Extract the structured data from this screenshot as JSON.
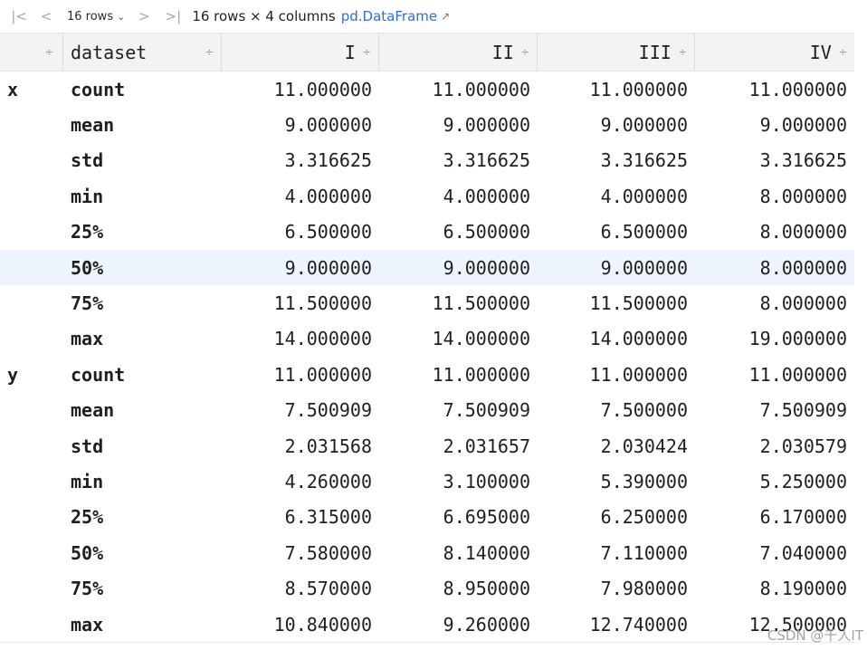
{
  "toolbar": {
    "first_icon": "|<",
    "prev_icon": "<",
    "rows_value": "16 rows",
    "chevron_icon": "⌄",
    "next_icon": ">",
    "last_icon": ">|",
    "summary": "16 rows × 4 columns",
    "dataframe_link": "pd.DataFrame",
    "external_icon": "↗"
  },
  "headers": {
    "index_sort": "÷",
    "dataset": "dataset",
    "dataset_sort": "÷",
    "columns": [
      {
        "label": "I",
        "sort": "÷"
      },
      {
        "label": "II",
        "sort": "÷"
      },
      {
        "label": "III",
        "sort": "÷"
      },
      {
        "label": "IV",
        "sort": "÷"
      }
    ]
  },
  "rows": [
    {
      "lvl0": "x",
      "lvl1": "count",
      "values": [
        "11.000000",
        "11.000000",
        "11.000000",
        "11.000000"
      ]
    },
    {
      "lvl0": "",
      "lvl1": "mean",
      "values": [
        "9.000000",
        "9.000000",
        "9.000000",
        "9.000000"
      ]
    },
    {
      "lvl0": "",
      "lvl1": "std",
      "values": [
        "3.316625",
        "3.316625",
        "3.316625",
        "3.316625"
      ]
    },
    {
      "lvl0": "",
      "lvl1": "min",
      "values": [
        "4.000000",
        "4.000000",
        "4.000000",
        "8.000000"
      ]
    },
    {
      "lvl0": "",
      "lvl1": "25%",
      "values": [
        "6.500000",
        "6.500000",
        "6.500000",
        "8.000000"
      ]
    },
    {
      "lvl0": "",
      "lvl1": "50%",
      "values": [
        "9.000000",
        "9.000000",
        "9.000000",
        "8.000000"
      ]
    },
    {
      "lvl0": "",
      "lvl1": "75%",
      "values": [
        "11.500000",
        "11.500000",
        "11.500000",
        "8.000000"
      ]
    },
    {
      "lvl0": "",
      "lvl1": "max",
      "values": [
        "14.000000",
        "14.000000",
        "14.000000",
        "19.000000"
      ]
    },
    {
      "lvl0": "y",
      "lvl1": "count",
      "values": [
        "11.000000",
        "11.000000",
        "11.000000",
        "11.000000"
      ]
    },
    {
      "lvl0": "",
      "lvl1": "mean",
      "values": [
        "7.500909",
        "7.500909",
        "7.500000",
        "7.500909"
      ]
    },
    {
      "lvl0": "",
      "lvl1": "std",
      "values": [
        "2.031568",
        "2.031657",
        "2.030424",
        "2.030579"
      ]
    },
    {
      "lvl0": "",
      "lvl1": "min",
      "values": [
        "4.260000",
        "3.100000",
        "5.390000",
        "5.250000"
      ]
    },
    {
      "lvl0": "",
      "lvl1": "25%",
      "values": [
        "6.315000",
        "6.695000",
        "6.250000",
        "6.170000"
      ]
    },
    {
      "lvl0": "",
      "lvl1": "50%",
      "values": [
        "7.580000",
        "8.140000",
        "7.110000",
        "7.040000"
      ]
    },
    {
      "lvl0": "",
      "lvl1": "75%",
      "values": [
        "8.570000",
        "8.950000",
        "7.980000",
        "8.190000"
      ]
    },
    {
      "lvl0": "",
      "lvl1": "max",
      "values": [
        "10.840000",
        "9.260000",
        "12.740000",
        "12.500000"
      ]
    }
  ],
  "highlighted_row": 5,
  "watermark": "CSDN @千人IT",
  "colors": {
    "header_bg": "#f2f3f5",
    "highlight_row": "#eef4fc",
    "link": "#2f6fd6"
  }
}
